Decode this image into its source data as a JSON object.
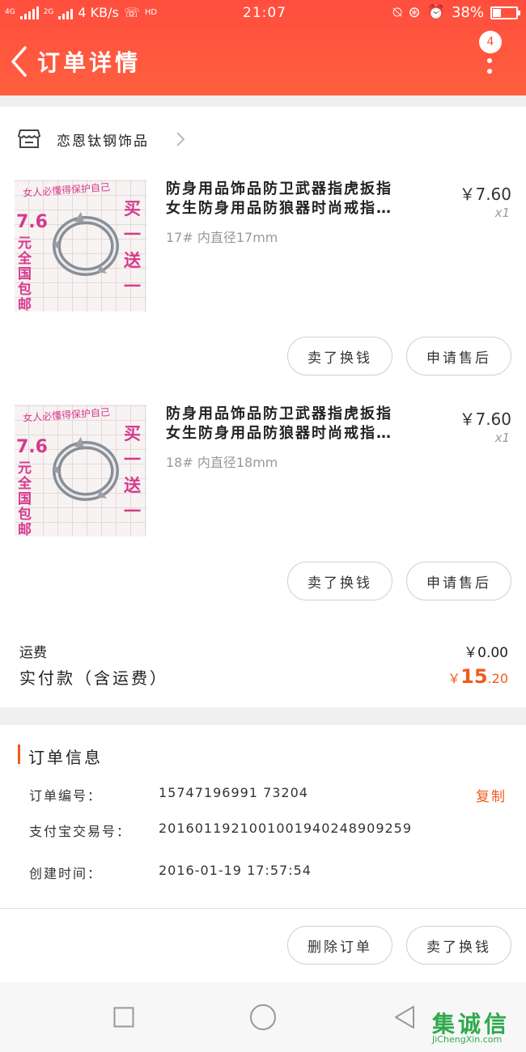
{
  "status_bar": {
    "network": "4G",
    "network2": "2G",
    "speed": "4 KB/s",
    "hd": "HD",
    "time": "21:07",
    "battery": "38%"
  },
  "header": {
    "title": "订单详情",
    "badge_count": "4"
  },
  "shop": {
    "name": "恋恩钛钢饰品"
  },
  "thumbnail": {
    "caption": "女人必懂得保护自己",
    "price": "7.6",
    "free_shipping": "元全国包邮",
    "promo": "买一送一"
  },
  "items": [
    {
      "name_line1": "防身用品饰品防卫武器指虎扳指",
      "name_line2": "女生防身用品防狼器时尚戒指…",
      "spec": "17# 内直径17mm",
      "price": "￥7.60",
      "qty": "x1",
      "btn_sell": "卖了换钱",
      "btn_aftersale": "申请售后"
    },
    {
      "name_line1": "防身用品饰品防卫武器指虎扳指",
      "name_line2": "女生防身用品防狼器时尚戒指…",
      "spec": "18# 内直径18mm",
      "price": "￥7.60",
      "qty": "x1",
      "btn_sell": "卖了换钱",
      "btn_aftersale": "申请售后"
    }
  ],
  "summary": {
    "shipping_label": "运费",
    "shipping_value": "￥0.00",
    "total_label": "实付款（含运费）",
    "total_currency": "￥",
    "total_int": "15",
    "total_dec": ".20"
  },
  "order_info": {
    "title": "订单信息",
    "rows": [
      {
        "key": "订单编号：",
        "value": "15747196991 73204"
      },
      {
        "key": "支付宝交易号：",
        "value": "2016011921001001940248909259"
      },
      {
        "key": "创建时间：",
        "value": "2016-01-19 17:57:54"
      }
    ],
    "copy_label": "复制"
  },
  "bottom_actions": {
    "delete": "删除订单",
    "sell": "卖了换钱"
  },
  "watermark": {
    "mark": "集诚信",
    "url": "JiChengXin.com"
  },
  "colors": {
    "header": "#ff4e3e",
    "accent": "#f15a1f",
    "thumb_text": "#d63a8c",
    "watermark": "#2eaa4e"
  }
}
